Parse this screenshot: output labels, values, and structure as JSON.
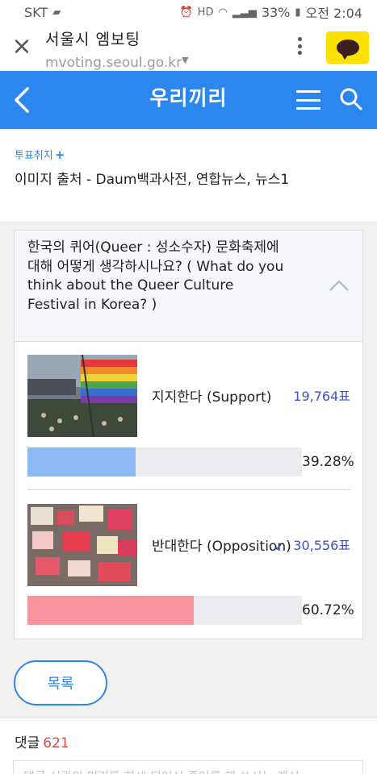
{
  "status_bar": {
    "carrier": "SKT",
    "battery": "33%",
    "time": "오전 2:04"
  },
  "browser": {
    "title": "서울시 엠보팅",
    "url": "mvoting.seoul.go.kr"
  },
  "header": {
    "title": "우리끼리"
  },
  "info": {
    "vote_cancel": "투표취지",
    "source": "이미지 출처 - Daum백과사전, 연합뉴스, 뉴스1"
  },
  "poll": {
    "question": "한국의 퀴어(Queer : 성소수자) 문화축제에 대해 어떻게 생각하시나요? ( What do you think about the Queer Culture Festival in Korea? )",
    "options": [
      {
        "label": "지지한다 (Support)",
        "votes": "19,764표",
        "percent": "39.28%",
        "fraction": 0.3928,
        "color": "#8dbaf5"
      },
      {
        "label": "반대한다 (Opposition)",
        "votes": "30,556표",
        "percent": "60.72%",
        "fraction": 0.6072,
        "color": "#f7939d"
      }
    ]
  },
  "list_button": "목록",
  "comments": {
    "title": "댓글",
    "count": "621",
    "placeholder": "댓글 서관의 미리를 하세 되어시 즐어를 해 쓰시는 게시"
  },
  "colors": {
    "accent": "#2b86ee",
    "vote_count": "#3b52c9"
  }
}
